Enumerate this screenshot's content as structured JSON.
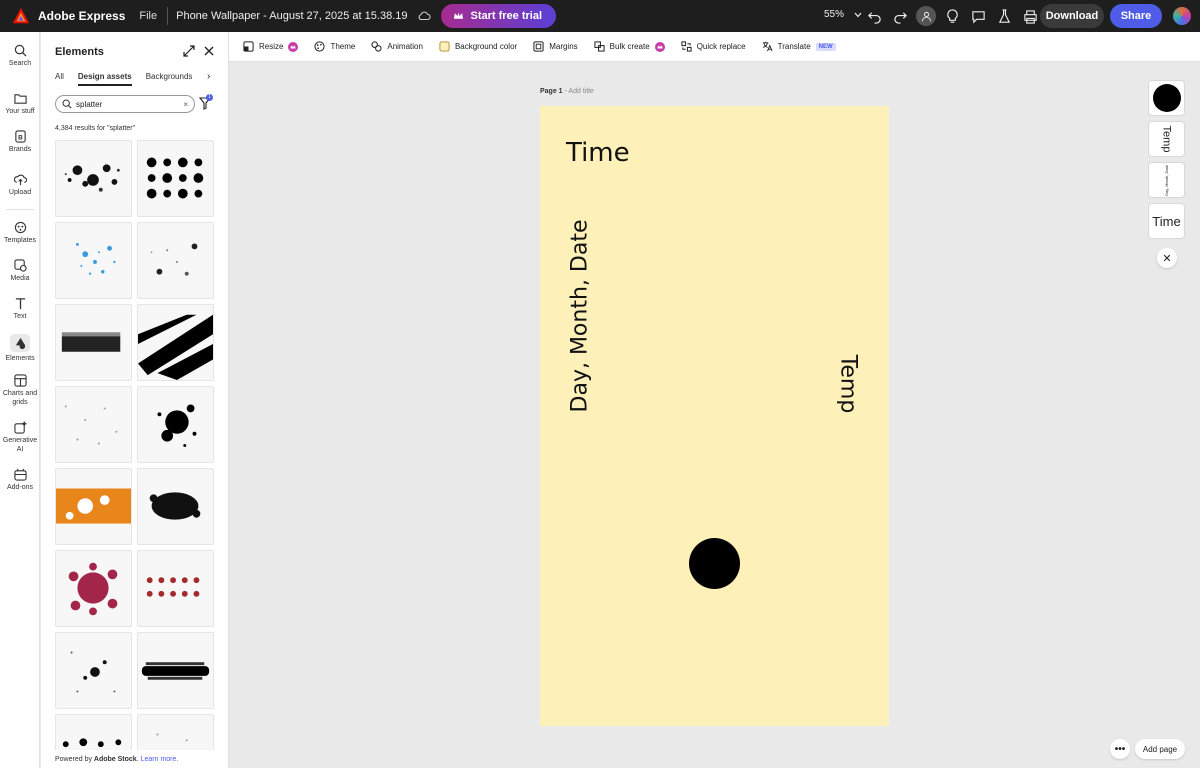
{
  "topbar": {
    "brand": "Adobe Express",
    "file_menu": "File",
    "doc_title": "Phone Wallpaper - August 27, 2025 at 15.38.19",
    "trial_label": "Start free trial",
    "zoom": "55%",
    "download_label": "Download",
    "share_label": "Share"
  },
  "rail": {
    "items": [
      {
        "label": "Search",
        "icon": "search-icon"
      },
      {
        "label": "Your stuff",
        "icon": "folder-icon"
      },
      {
        "label": "Brands",
        "icon": "brand-icon"
      },
      {
        "label": "Upload",
        "icon": "upload-icon"
      },
      {
        "label": "Templates",
        "icon": "templates-icon"
      },
      {
        "label": "Media",
        "icon": "media-icon"
      },
      {
        "label": "Text",
        "icon": "text-icon"
      },
      {
        "label": "Elements",
        "icon": "elements-icon"
      },
      {
        "label": "Charts and grids",
        "icon": "charts-icon"
      },
      {
        "label": "Generative AI",
        "icon": "genai-icon"
      },
      {
        "label": "Add-ons",
        "icon": "addons-icon"
      }
    ]
  },
  "panel": {
    "title": "Elements",
    "tabs": [
      "All",
      "Design assets",
      "Backgrounds"
    ],
    "search_value": "splatter",
    "filter_count": "1",
    "results": "4,384 results for \"splatter\"",
    "powered_prefix": "Powered by ",
    "powered_brand": "Adobe Stock",
    "powered_suffix": ". ",
    "learn_more": "Learn more."
  },
  "toolbar": {
    "resize": "Resize",
    "theme": "Theme",
    "animation": "Animation",
    "background_color": "Background color",
    "margins": "Margins",
    "bulk_create": "Bulk create",
    "quick_replace": "Quick replace",
    "translate": "Translate",
    "new_badge": "NEW"
  },
  "canvas": {
    "page_label": "Page 1",
    "page_sep": " - ",
    "title_placeholder": "Add title",
    "background": "#fdf0b8",
    "texts": {
      "time": "Time",
      "date": "Day, Month, Date",
      "temp": "Temp"
    }
  },
  "layers": {
    "temp": "Temp",
    "date": "Day, Month, Date",
    "time": "Time"
  },
  "footer": {
    "add_page": "Add page"
  },
  "colors": {
    "accent": "#4f5ce8",
    "trial_gradient_start": "#a52c8f",
    "trial_gradient_end": "#5b3fd6",
    "topbar": "#1e1e1e"
  }
}
